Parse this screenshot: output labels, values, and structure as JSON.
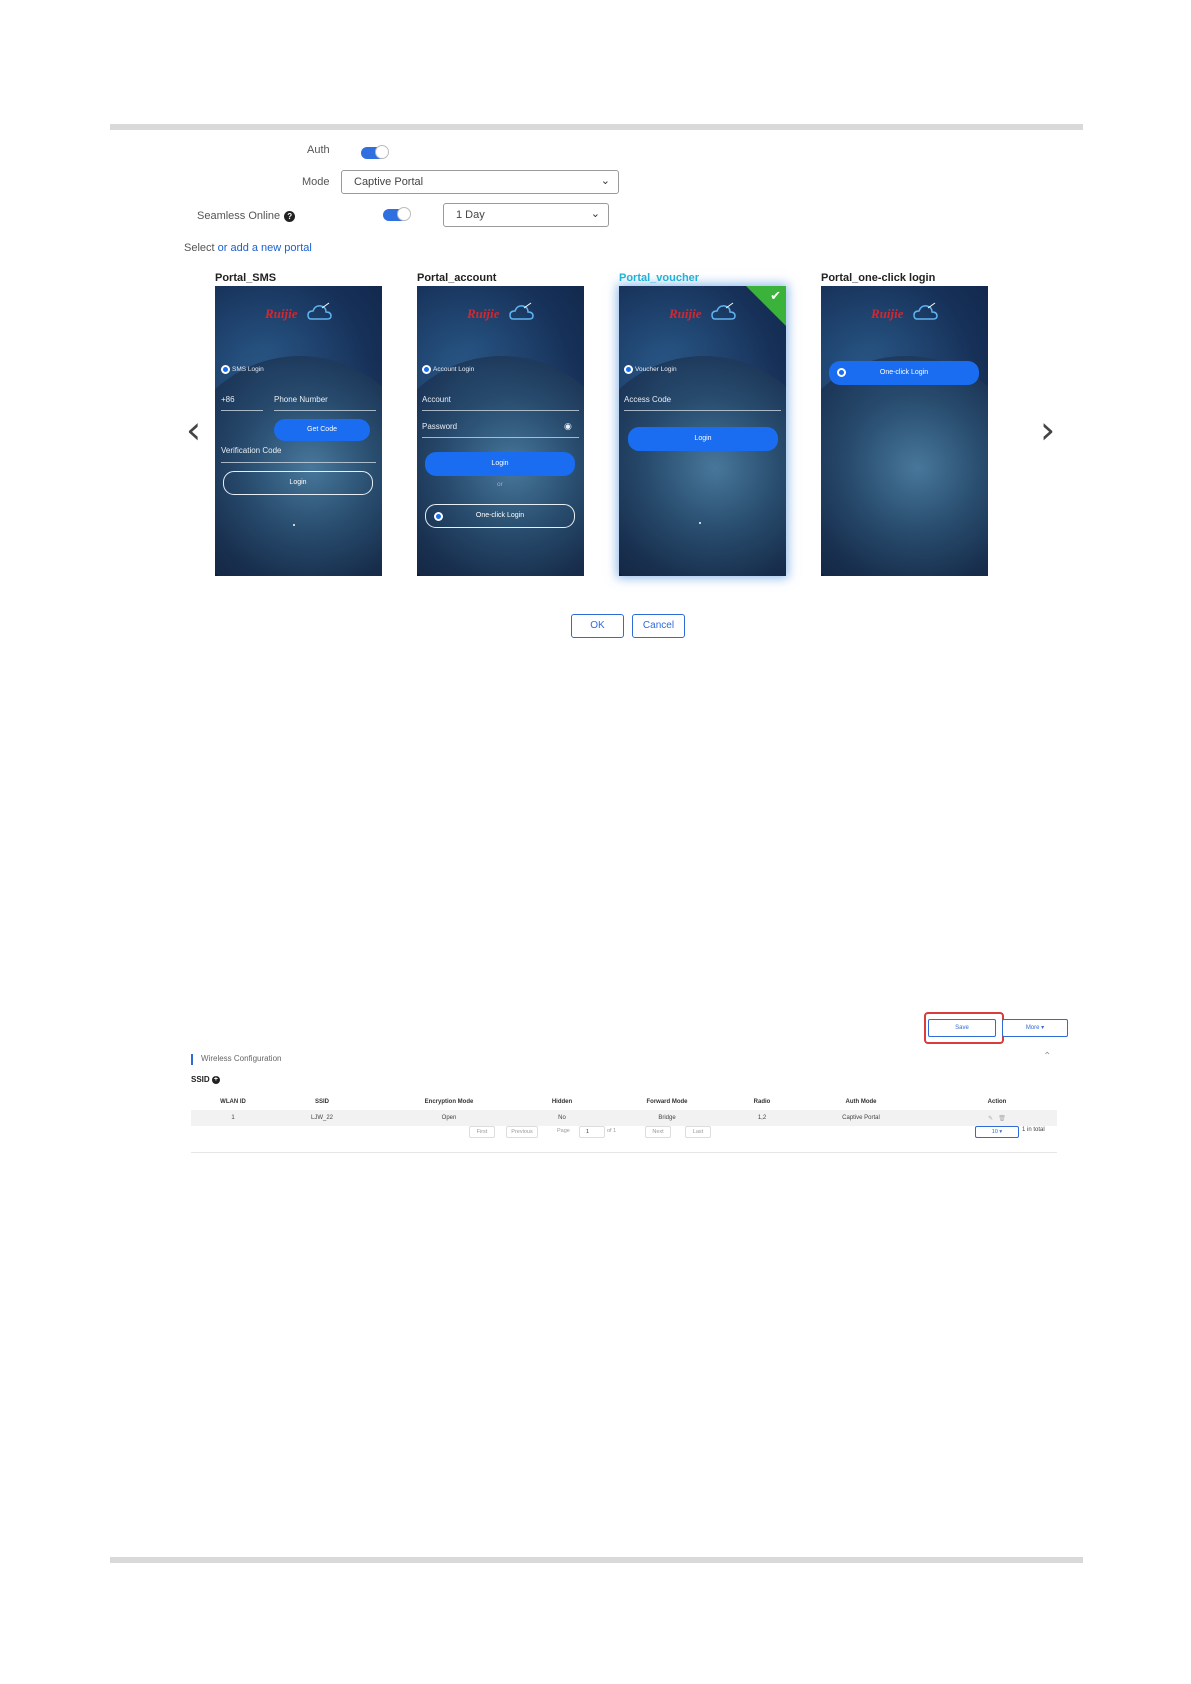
{
  "form": {
    "auth_label": "Auth",
    "mode_label": "Mode",
    "mode_value": "Captive Portal",
    "seamless_label": "Seamless Online",
    "seamless_value": "1 Day",
    "select_text": "Select",
    "add_portal_text": "or add a new portal"
  },
  "portals": [
    {
      "title": "Portal_SMS",
      "brand": "Ruijie",
      "login_type": "SMS Login",
      "country_code": "+86",
      "phone_placeholder": "Phone Number",
      "get_code_label": "Get Code",
      "verification_label": "Verification Code",
      "login_label": "Login"
    },
    {
      "title": "Portal_account",
      "brand": "Ruijie",
      "login_type": "Account Login",
      "account_label": "Account",
      "password_label": "Password",
      "login_label": "Login",
      "or_label": "or",
      "oneclick_label": "One-click Login"
    },
    {
      "title": "Portal_voucher",
      "brand": "Ruijie",
      "login_type": "Voucher Login",
      "access_code_label": "Access Code",
      "login_label": "Login",
      "selected": true
    },
    {
      "title": "Portal_one-click login",
      "brand": "Ruijie",
      "oneclick_label": "One-click Login"
    }
  ],
  "dialog_buttons": {
    "ok": "OK",
    "cancel": "Cancel"
  },
  "wireless": {
    "save_label": "Save",
    "more_label": "More ▾",
    "section_title": "Wireless Configuration",
    "ssid_label": "SSID",
    "columns": [
      "WLAN ID",
      "SSID",
      "Encryption Mode",
      "Hidden",
      "Forward Mode",
      "Radio",
      "Auth Mode",
      "Action"
    ],
    "rows": [
      [
        "1",
        "LJW_22",
        "Open",
        "No",
        "Bridge",
        "1,2",
        "Captive Portal",
        ""
      ]
    ],
    "pager": {
      "first": "First",
      "previous": "Previous",
      "page_label": "Page",
      "page_value": "1",
      "of_label": "of 1",
      "next": "Next",
      "last": "Last",
      "page_size": "10 ▾",
      "total": "1 in total"
    }
  },
  "colors": {
    "accent": "#2e6bd6",
    "selected_title": "#1fb6d6",
    "check_green": "#3bb33b",
    "highlight": "#d83c3c"
  }
}
